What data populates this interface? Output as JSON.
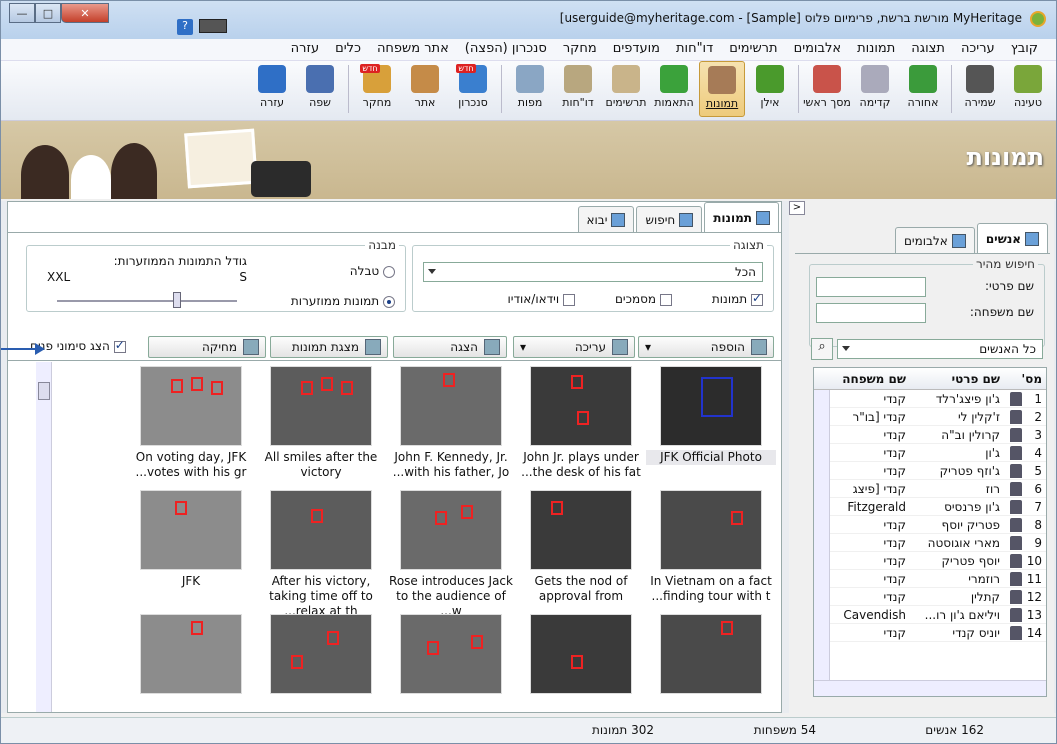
{
  "window": {
    "title": "MyHeritage מורשת ברשת, פרימיום פלוס [Sample] - userguide@myheritage.com]"
  },
  "menu": [
    "קובץ",
    "עריכה",
    "תצוגה",
    "תמונות",
    "אלבומים",
    "תרשימים",
    "דו\"חות",
    "מועדפים",
    "מחקר",
    "סנכרון (הפצה)",
    "אתר משפחה",
    "כלים",
    "עזרה"
  ],
  "toolbar": [
    {
      "label": "טעינה",
      "icon": "folder-icon",
      "color": "#7aa63a"
    },
    {
      "label": "שמירה",
      "icon": "save-icon",
      "color": "#555"
    },
    {
      "sep": true
    },
    {
      "label": "אחורה",
      "icon": "back-icon",
      "color": "#3b9b3b"
    },
    {
      "label": "קדימה",
      "icon": "forward-icon",
      "color": "#aab"
    },
    {
      "label": "מסך ראשי",
      "icon": "home-icon",
      "color": "#c9534a"
    },
    {
      "sep": true
    },
    {
      "label": "אילן",
      "icon": "tree-icon",
      "color": "#4a9a2c"
    },
    {
      "label": "תמונות",
      "icon": "photos-icon",
      "color": "#a67b57",
      "active": true
    },
    {
      "label": "התאמות",
      "icon": "matches-icon",
      "color": "#3ba23b"
    },
    {
      "label": "תרשימים",
      "icon": "charts-icon",
      "color": "#c9b48a"
    },
    {
      "label": "דו\"חות",
      "icon": "reports-icon",
      "color": "#b8a77f"
    },
    {
      "label": "מפות",
      "icon": "maps-icon",
      "color": "#8aa6c4"
    },
    {
      "sep": true
    },
    {
      "label": "סנכרון",
      "icon": "sync-icon",
      "color": "#3a7fcf",
      "badge": "חדש"
    },
    {
      "label": "אתר",
      "icon": "site-icon",
      "color": "#c58b48"
    },
    {
      "label": "מחקר",
      "icon": "research-icon",
      "color": "#d8a03a",
      "badge": "חדש"
    },
    {
      "sep": true
    },
    {
      "label": "שפה",
      "icon": "language-icon",
      "color": "#4a6fb0"
    },
    {
      "label": "עזרה",
      "icon": "help-icon",
      "color": "#2f6fc6"
    }
  ],
  "banner": {
    "title": "תמונות"
  },
  "left": {
    "tabs": [
      "תמונות",
      "חיפוש",
      "יבוא"
    ],
    "view": {
      "legend": "תצוגה",
      "filter": "הכל",
      "checks": [
        {
          "label": "תמונות",
          "on": true
        },
        {
          "label": "מסמכים",
          "on": false
        },
        {
          "label": "וידאו/אודיו",
          "on": false
        }
      ]
    },
    "structure": {
      "legend": "מבנה",
      "opt1": "טבלה",
      "opt2": "תמונות ממוזערות",
      "size_label": "גודל התמונות הממוזערות:",
      "size_min": "S",
      "size_max": "XXL"
    },
    "buttons": [
      "הוספה",
      "עריכה",
      "הצגה",
      "מצגת תמונות",
      "מחיקה"
    ],
    "show_faces": "הצג סימוני פנים",
    "photos": [
      {
        "caption": "JFK Official Photo",
        "sel": true
      },
      {
        "caption": "John Jr. plays under the desk of his fat..."
      },
      {
        "caption": "John F. Kennedy, Jr. with his father, Jo..."
      },
      {
        "caption": "All smiles after the victory"
      },
      {
        "caption": "On voting day, JFK votes with his gr..."
      },
      {
        "caption": "In Vietnam on a fact finding tour with t..."
      },
      {
        "caption": "Gets the nod of approval from"
      },
      {
        "caption": "Rose introduces Jack to the audience of w..."
      },
      {
        "caption": "After his victory, taking time off to relax at th..."
      },
      {
        "caption": "JFK"
      },
      {
        "caption": ""
      },
      {
        "caption": ""
      },
      {
        "caption": ""
      },
      {
        "caption": ""
      },
      {
        "caption": ""
      }
    ]
  },
  "right": {
    "tabs": [
      "אנשים",
      "אלבומים"
    ],
    "quick": {
      "legend": "חיפוש מהיר",
      "first": "שם פרטי:",
      "last": "שם משפחה:"
    },
    "filter": "כל האנשים",
    "headers": [
      "מס'",
      "שם פרטי",
      "שם משפחה"
    ],
    "rows": [
      [
        "1",
        "ג'ון פיצג'רלד",
        "קנדי"
      ],
      [
        "2",
        "ז'קלין לי",
        "קנדי [בו\"ר"
      ],
      [
        "3",
        "קרולין וב\"ה",
        "קנדי"
      ],
      [
        "4",
        "ג'ון",
        "קנדי"
      ],
      [
        "5",
        "ג'וזף פטריק",
        "קנדי"
      ],
      [
        "6",
        "רוז",
        "קנדי [פיצג"
      ],
      [
        "7",
        "ג'ון פרנסיס",
        "Fitzgerald"
      ],
      [
        "8",
        "פטריק יוסף",
        "קנדי"
      ],
      [
        "9",
        "מארי אוגוסטה",
        "קנדי"
      ],
      [
        "10",
        "יוסף פטריק",
        "קנדי"
      ],
      [
        "11",
        "רוזמרי",
        "קנדי"
      ],
      [
        "12",
        "קתלין",
        "קנדי"
      ],
      [
        "13",
        "ויליאם ג'ון רו...",
        "Cavendish"
      ],
      [
        "14",
        "יוניס קנדי",
        "קנדי"
      ]
    ]
  },
  "status": {
    "people": "162 אנשים",
    "families": "54 משפחות",
    "photos": "302 תמונות"
  }
}
